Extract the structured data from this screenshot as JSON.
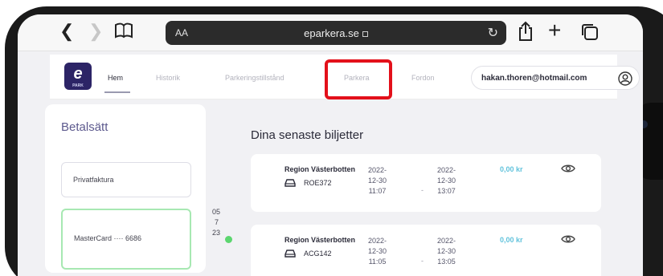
{
  "browser": {
    "address_left": "AA",
    "url": "eparkera.se"
  },
  "site": {
    "logo_letter": "e",
    "logo_sub": "PARK",
    "nav": [
      "Hem",
      "Historik",
      "Parkeringstillstånd",
      "Parkera",
      "Fordon"
    ],
    "active_nav": "Hem",
    "highlighted_nav": "Parkera",
    "user_email": "hakan.thoren@hotmail.com"
  },
  "payment": {
    "title": "Betalsätt",
    "options": [
      {
        "label": "Privatfaktura",
        "selected": false
      },
      {
        "label": "MasterCard ···· 6686",
        "selected": true
      }
    ],
    "overflow_lines": [
      "05",
      "7",
      "23"
    ]
  },
  "tickets": {
    "title": "Dina senaste biljetter",
    "items": [
      {
        "region": "Region Västerbotten",
        "plate": "ROE372",
        "start_date": "2022-",
        "start_mid": "12-30",
        "start_time": "11:07",
        "end_date": "2022-",
        "end_mid": "12-30",
        "end_time": "13:07",
        "dash": "-",
        "amount": "0,00 kr"
      },
      {
        "region": "Region Västerbotten",
        "plate": "ACG142",
        "start_date": "2022-",
        "start_mid": "12-30",
        "start_time": "11:05",
        "end_date": "2022-",
        "end_mid": "12-30",
        "end_time": "13:05",
        "dash": "-",
        "amount": "0,00 kr"
      }
    ]
  },
  "colors": {
    "brand": "#2c2466",
    "highlight": "#e3101a",
    "amount": "#62c3dc",
    "selected_border": "#a7e8b2"
  }
}
